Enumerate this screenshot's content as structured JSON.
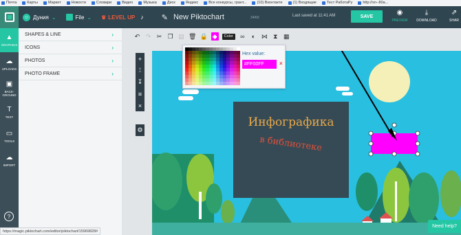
{
  "bookmarks": [
    "Почта",
    "Карты",
    "Маркет",
    "Новости",
    "Словари",
    "Видео",
    "Музыка",
    "Диск",
    "Яндекс",
    "Все конкурсы, грант...",
    "(10) Вконтакте",
    "(1) Входящие",
    "Тест РаботаРу",
    "http://xn--80a..."
  ],
  "header": {
    "user_name": "Дуния",
    "file_label": "File",
    "level_up_label": "LEVEL UP",
    "doc_title": "New Piktochart",
    "version_text": "24/60",
    "saved_text": "Last saved at 11:41 AM",
    "save_label": "SAVE",
    "preview_label": "PREVIEW",
    "download_label": "DOWNLOAD",
    "share_label": "SHAR"
  },
  "rail": [
    {
      "label": "GRAPHICS",
      "icon": "graphics-icon"
    },
    {
      "label": "UPLOADS",
      "icon": "upload-icon"
    },
    {
      "label": "BACK-\nGROUND",
      "icon": "background-icon"
    },
    {
      "label": "TEXT",
      "icon": "text-icon"
    },
    {
      "label": "TOOLS",
      "icon": "tools-icon"
    },
    {
      "label": "IMPORT",
      "icon": "import-icon"
    }
  ],
  "panel": {
    "items": [
      {
        "label": "SHAPES & LINE"
      },
      {
        "label": "ICONS"
      },
      {
        "label": "PHOTOS"
      },
      {
        "label": "PHOTO FRAME"
      }
    ]
  },
  "toolbar": {
    "color_label": "Color"
  },
  "picker": {
    "hex_label": "Hex value:",
    "hex_value": "#FF00FF",
    "close": "×"
  },
  "artboard": {
    "title_text": "Инфографика",
    "subtitle_text": "в библиотеке"
  },
  "colors": {
    "accent": "#24c6a4",
    "selected_shape": "#FF00FF",
    "sky": "#29bfe0",
    "board": "#2f3e46",
    "title_color": "#e8a84a",
    "subtitle_color": "#e0503a"
  },
  "status_url": "https://magic.piktochart.com/editor/piktochart/15969828#",
  "need_help_label": "Need help?"
}
